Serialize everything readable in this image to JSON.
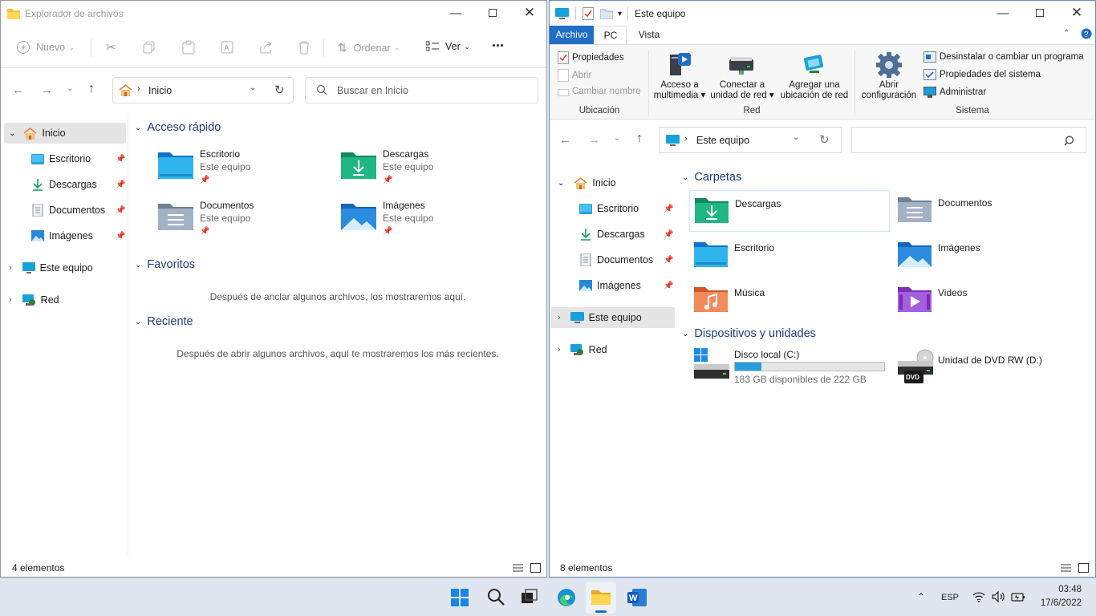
{
  "left": {
    "title": "Explorador de archivos",
    "toolbar": {
      "new": "Nuevo",
      "sort": "Ordenar",
      "view": "Ver",
      "more": "···"
    },
    "address": "Inicio",
    "search_placeholder": "Buscar en Inicio",
    "nav": {
      "home": "Inicio",
      "items": [
        "Escritorio",
        "Descargas",
        "Documentos",
        "Imágenes"
      ],
      "this_pc": "Este equipo",
      "network": "Red"
    },
    "quick_access_title": "Acceso rápido",
    "quick": [
      {
        "name": "Escritorio",
        "sub": "Este equipo"
      },
      {
        "name": "Descargas",
        "sub": "Este equipo"
      },
      {
        "name": "Documentos",
        "sub": "Este equipo"
      },
      {
        "name": "Imágenes",
        "sub": "Este equipo"
      }
    ],
    "favorites_title": "Favoritos",
    "favorites_empty": "Después de anclar algunos archivos, los mostraremos aquí.",
    "recent_title": "Reciente",
    "recent_empty": "Después de abrir algunos archivos, aquí te mostraremos los más recientes.",
    "status": "4 elementos"
  },
  "right": {
    "title": "Este equipo",
    "tabs": {
      "file": "Archivo",
      "pc": "PC",
      "view": "Vista"
    },
    "ribbon": {
      "properties": "Propiedades",
      "open": "Abrir",
      "rename": "Cambiar nombre",
      "location_group": "Ubicación",
      "media_1": "Acceso a",
      "media_2": "multimedia",
      "map_1": "Conectar a",
      "map_2": "unidad de red",
      "netloc_1": "Agregar una",
      "netloc_2": "ubicación de red",
      "network_group": "Red",
      "settings_1": "Abrir",
      "settings_2": "configuración",
      "uninstall": "Desinstalar o cambiar un programa",
      "sysprops": "Propiedades del sistema",
      "manage": "Administrar",
      "system_group": "Sistema"
    },
    "address": "Este equipo",
    "nav": {
      "home": "Inicio",
      "items": [
        "Escritorio",
        "Descargas",
        "Documentos",
        "Imágenes"
      ],
      "this_pc": "Este equipo",
      "network": "Red"
    },
    "folders_title": "Carpetas",
    "folders": [
      "Descargas",
      "Documentos",
      "Escritorio",
      "Imágenes",
      "Música",
      "Videos"
    ],
    "devices_title": "Dispositivos y unidades",
    "disk_name": "Disco local (C:)",
    "disk_free": "183 GB disponibles de 222 GB",
    "disk_used_fraction": 0.176,
    "dvd_name": "Unidad de DVD RW (D:)",
    "dvd_label": "DVD",
    "status": "8 elementos"
  },
  "taskbar": {
    "lang": "ESP",
    "time": "03:48",
    "date": "17/6/2022"
  },
  "colors": {
    "accent": "#1f6fc5",
    "section": "#1f3b80",
    "disk_bar": "#26a0da"
  }
}
